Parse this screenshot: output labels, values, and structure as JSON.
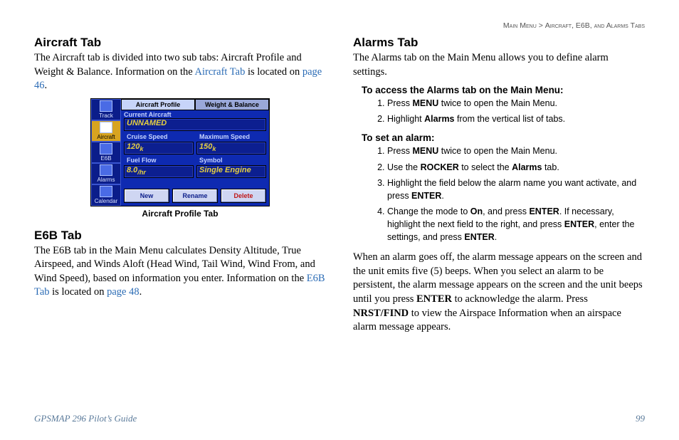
{
  "breadcrumb": {
    "left": "Main Menu",
    "sep": " > ",
    "right": "Aircraft, E6B, and Alarms Tabs"
  },
  "left": {
    "h_aircraft": "Aircraft Tab",
    "p_aircraft_a": "The Aircraft tab is divided into two sub tabs: Aircraft Profile and Weight & Balance. Information on the ",
    "link_aircraft": "Aircraft Tab",
    "p_aircraft_b": " is located on ",
    "link_page46": "page 46",
    "p_aircraft_c": ".",
    "caption": "Aircraft Profile Tab",
    "h_e6b": "E6B Tab",
    "p_e6b_a": "The E6B tab in the Main Menu calculates Density Altitude, True Airspeed, and Winds Aloft (Head Wind, Tail Wind, Wind From, and Wind Speed), based on information you enter. Information on the ",
    "link_e6b": "E6B Tab",
    "p_e6b_b": " is located on ",
    "link_page48": "page 48",
    "p_e6b_c": "."
  },
  "right": {
    "h_alarms": "Alarms Tab",
    "p_alarms": "The Alarms tab on the Main Menu allows you to define alarm settings.",
    "head_access": "To access the Alarms tab on the Main Menu:",
    "access": {
      "s1a": "Press ",
      "s1b": "MENU",
      "s1c": " twice to open the Main Menu.",
      "s2a": "Highlight ",
      "s2b": "Alarms",
      "s2c": " from the vertical list of tabs."
    },
    "head_set": "To set an alarm:",
    "set": {
      "s1a": "Press ",
      "s1b": "MENU",
      "s1c": " twice to open the Main Menu.",
      "s2a": "Use the ",
      "s2b": "ROCKER",
      "s2c": " to select the ",
      "s2d": "Alarms",
      "s2e": " tab.",
      "s3a": "Highlight the field below the alarm name you want activate, and press ",
      "s3b": "ENTER",
      "s3c": ".",
      "s4a": "Change the mode to ",
      "s4b": "On",
      "s4c": ", and press ",
      "s4d": "ENTER",
      "s4e": ". If necessary, highlight the next field to the right, and press ",
      "s4f": "ENTER",
      "s4g": ", enter the settings, and press ",
      "s4h": "ENTER",
      "s4i": "."
    },
    "p_after_a": "When an alarm goes off, the alarm message appears on the screen and the unit emits five (5) beeps. When you select an alarm to be persistent, the alarm message appears on the screen and the unit beeps until you press ",
    "p_after_b": "ENTER",
    "p_after_c": " to acknowledge the alarm. Press ",
    "p_after_d": "NRST/FIND",
    "p_after_e": " to view the Airspace Information when an airspace alarm message appears."
  },
  "footer": {
    "guide": "GPSMAP 296 Pilot’s Guide",
    "page": "99"
  },
  "shot": {
    "side": {
      "track": "Track",
      "aircraft": "Aircraft",
      "e6b": "E6B",
      "alarms": "Alarms",
      "calendar": "Calendar"
    },
    "tabs": {
      "profile": "Aircraft Profile",
      "wb": "Weight & Balance"
    },
    "labels": {
      "cur": "Current Aircraft",
      "cs": "Cruise Speed",
      "ms": "Maximum Speed",
      "ff": "Fuel Flow",
      "sym": "Symbol"
    },
    "vals": {
      "name": "UNNAMED",
      "cs": "120",
      "csu": "k",
      "ms": "150",
      "msu": "k",
      "ff": "8.0",
      "ffu": "/hr",
      "sym": "Single Engine"
    },
    "btns": {
      "new": "New",
      "rename": "Rename",
      "delete": "Delete"
    }
  }
}
